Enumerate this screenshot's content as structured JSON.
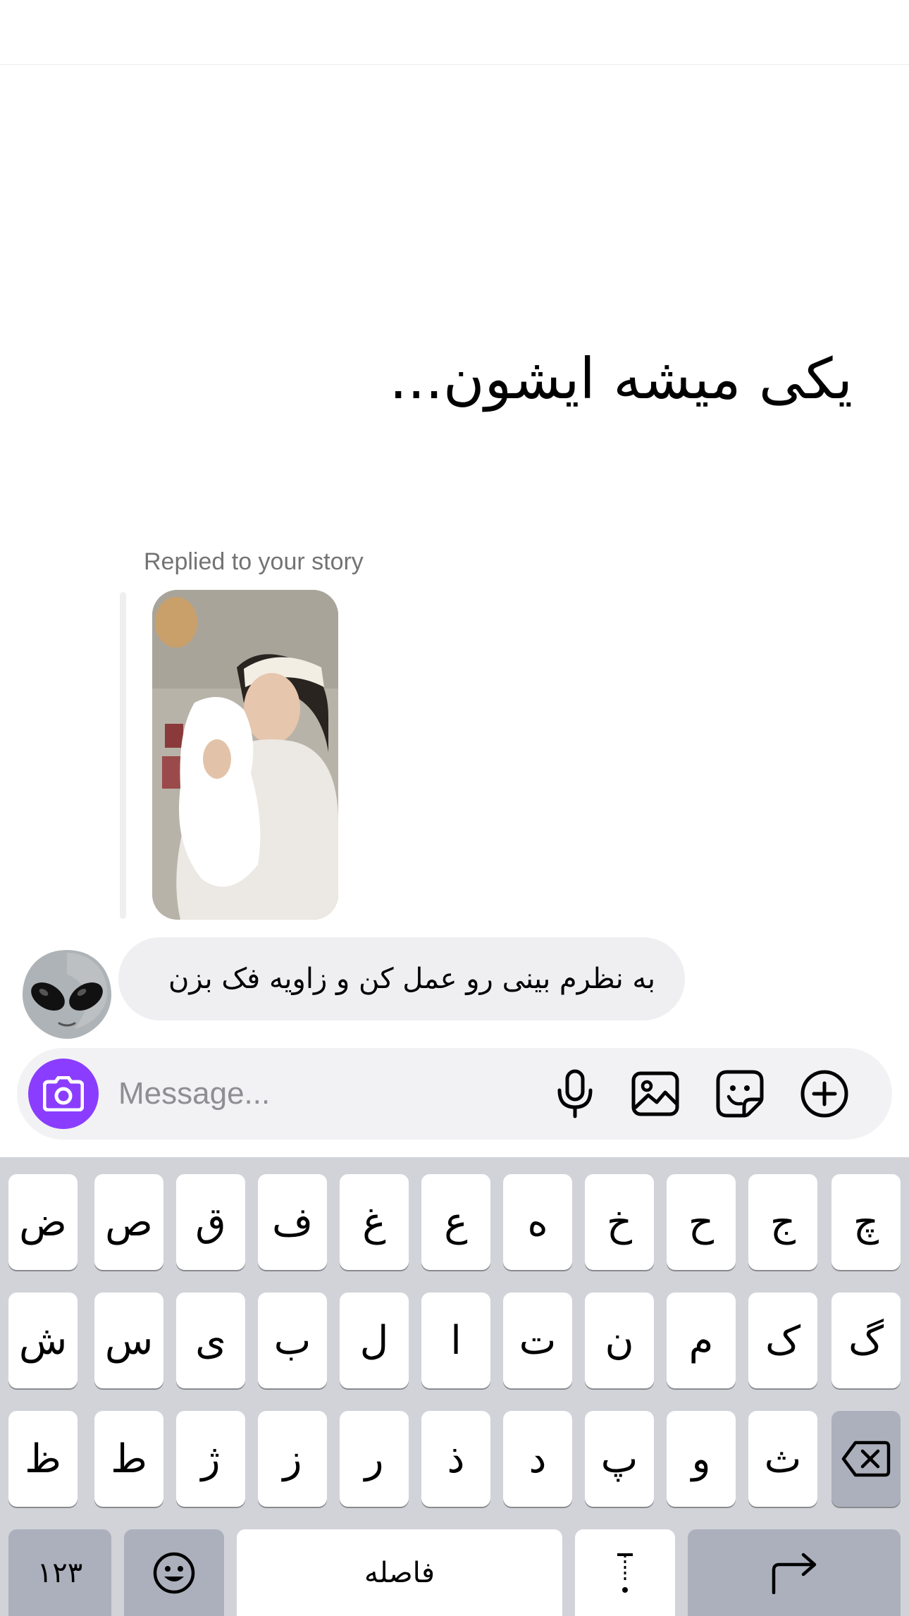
{
  "story": {
    "text": "یکی میشه ایشون..."
  },
  "conversation": {
    "replied_label": "Replied to your story",
    "message": "به نظرم بینی رو عمل کن و زاویه فک بزن",
    "avatar_icon": "alien-emoji"
  },
  "composer": {
    "placeholder": "Message...",
    "camera_icon": "camera-icon",
    "accent_color": "#8b3dff",
    "icons": [
      "microphone-icon",
      "gallery-icon",
      "sticker-icon",
      "plus-icon"
    ]
  },
  "keyboard": {
    "row1": [
      "ض",
      "ص",
      "ق",
      "ف",
      "غ",
      "ع",
      "ه",
      "خ",
      "ح",
      "ج",
      "چ"
    ],
    "row2": [
      "ش",
      "س",
      "ی",
      "ب",
      "ل",
      "ا",
      "ت",
      "ن",
      "م",
      "ک",
      "گ"
    ],
    "row3": [
      "ظ",
      "ط",
      "ژ",
      "ز",
      "ر",
      "ذ",
      "د",
      "پ",
      "و",
      "ث"
    ],
    "numbers_key": "۱۲۳",
    "space_key": "فاصله",
    "backspace_icon": "backspace-icon",
    "emoji_icon": "emoji-icon",
    "punctuation_icon": "punctuation-icon",
    "return_icon": "return-icon"
  }
}
